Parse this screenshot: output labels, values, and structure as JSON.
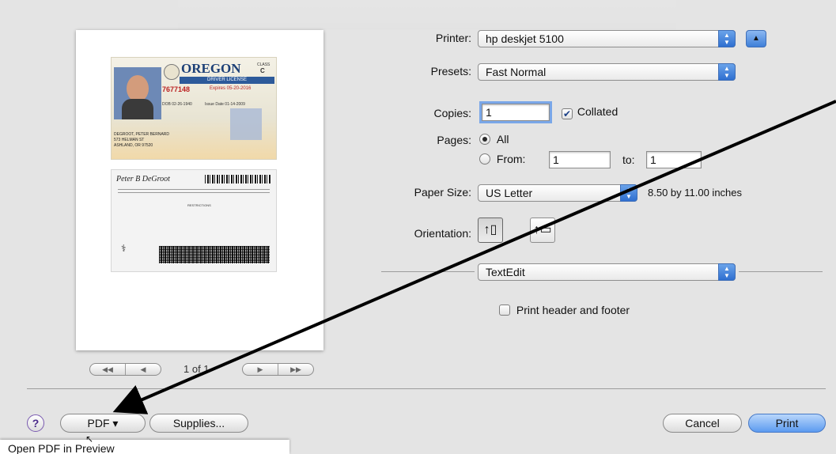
{
  "printer": {
    "label": "Printer:",
    "value": "hp deskjet 5100"
  },
  "presets": {
    "label": "Presets:",
    "value": "Fast Normal"
  },
  "copies": {
    "label": "Copies:",
    "value": "1",
    "collated_label": "Collated",
    "collated": true
  },
  "pages": {
    "label": "Pages:",
    "all_label": "All",
    "from_label": "From:",
    "from_value": "1",
    "to_label": "to:",
    "to_value": "1",
    "selected": "all"
  },
  "paper_size": {
    "label": "Paper Size:",
    "value": "US Letter",
    "dimensions": "8.50 by 11.00 inches"
  },
  "orientation": {
    "label": "Orientation:",
    "selected": "portrait"
  },
  "app_panel": {
    "value": "TextEdit"
  },
  "print_header": {
    "label": "Print header and footer",
    "checked": false
  },
  "preview": {
    "page_indicator": "1 of 1"
  },
  "license": {
    "state": "OREGON",
    "type": "DRIVER LICENSE",
    "class_label": "CLASS",
    "class": "C",
    "number": "7677148",
    "expires": "Expires 05-20-2016",
    "dob": "DOB 02-26-1940",
    "issue": "Issue Date 01-14-2009",
    "name": "DEGROOT, PETER BERNARD",
    "street": "573 HELMAN ST",
    "city": "ASHLAND, OR 97520",
    "signature": "Peter B DeGroot",
    "restrictions": "RESTRICTIONS"
  },
  "buttons": {
    "help": "?",
    "pdf": "PDF ▾",
    "supplies": "Supplies...",
    "cancel": "Cancel",
    "print": "Print"
  },
  "menu_peek": "Open PDF in Preview",
  "colors": {
    "accent": "#5c9bf0",
    "arrow": "#000000"
  }
}
